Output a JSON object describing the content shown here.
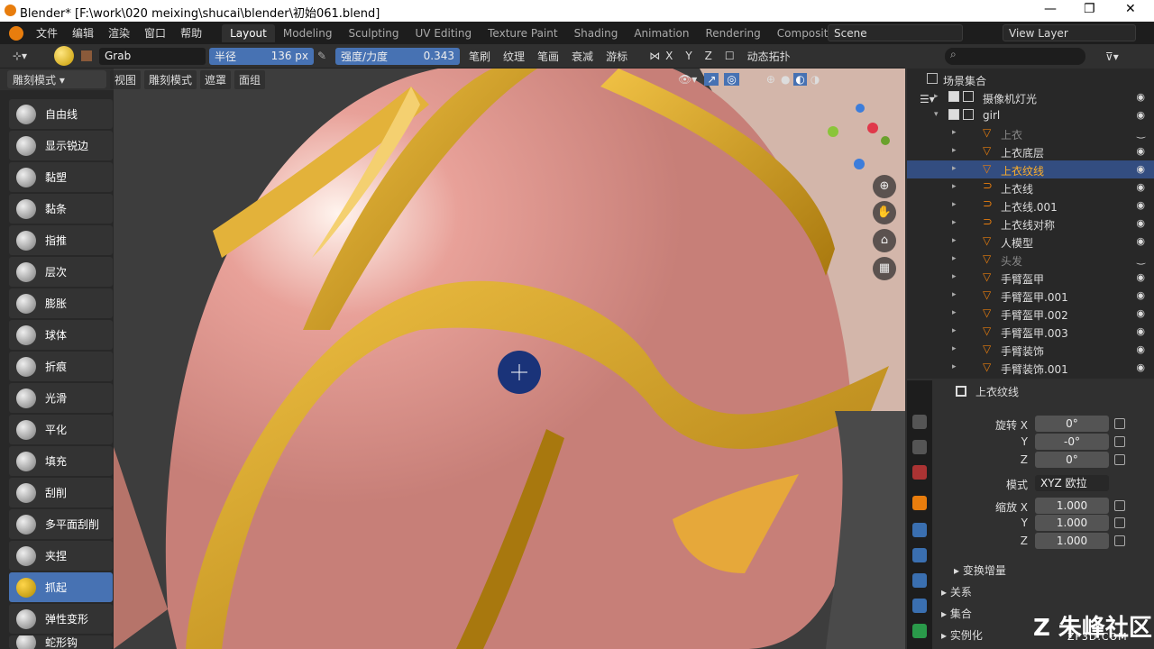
{
  "window": {
    "title": "Blender* [F:\\work\\020 meixing\\shucai\\blender\\初始061.blend]",
    "min": "—",
    "max": "❐",
    "close": "✕"
  },
  "menus": [
    "文件",
    "编辑",
    "渲染",
    "窗口",
    "帮助"
  ],
  "workspaces": [
    "Layout",
    "Modeling",
    "Sculpting",
    "UV Editing",
    "Texture Paint",
    "Shading",
    "Animation",
    "Rendering",
    "Compositing",
    "Sc"
  ],
  "scene": "Scene",
  "view_layer": "View Layer",
  "tool_header": {
    "brush": "Grab",
    "radius_label": "半径",
    "radius_value": "136 px",
    "strength_label": "强度/力度",
    "strength_value": "0.343",
    "menus": [
      "笔刷",
      "纹理",
      "笔画",
      "衰减",
      "游标"
    ],
    "axes": [
      "X",
      "Y",
      "Z"
    ],
    "dyntopo": "动态拓扑"
  },
  "viewport_header": {
    "mode": "雕刻模式",
    "menus": [
      "视图",
      "雕刻模式",
      "遮罩",
      "面组"
    ]
  },
  "tools": [
    "自由线",
    "显示锐边",
    "黏塑",
    "黏条",
    "指推",
    "层次",
    "膨胀",
    "球体",
    "折痕",
    "光滑",
    "平化",
    "填充",
    "刮削",
    "多平面刮削",
    "夹捏",
    "抓起",
    "弹性变形",
    "蛇形钩"
  ],
  "active_tool": "抓起",
  "outliner": {
    "root": "场景集合",
    "items": [
      {
        "name": "摄像机灯光",
        "level": 1,
        "type": "coll"
      },
      {
        "name": "girl",
        "level": 1,
        "type": "coll"
      },
      {
        "name": "上衣",
        "level": 2,
        "type": "mesh",
        "dim": true
      },
      {
        "name": "上衣底层",
        "level": 2,
        "type": "mesh"
      },
      {
        "name": "上衣纹线",
        "level": 2,
        "type": "mesh",
        "sel": true
      },
      {
        "name": "上衣线",
        "level": 2,
        "type": "curve"
      },
      {
        "name": "上衣线.001",
        "level": 2,
        "type": "curve"
      },
      {
        "name": "上衣线对称",
        "level": 2,
        "type": "curve"
      },
      {
        "name": "人模型",
        "level": 2,
        "type": "mesh"
      },
      {
        "name": "头发",
        "level": 2,
        "type": "mesh",
        "dim": true
      },
      {
        "name": "手臂盔甲",
        "level": 2,
        "type": "mesh"
      },
      {
        "name": "手臂盔甲.001",
        "level": 2,
        "type": "mesh"
      },
      {
        "name": "手臂盔甲.002",
        "level": 2,
        "type": "mesh"
      },
      {
        "name": "手臂盔甲.003",
        "level": 2,
        "type": "mesh"
      },
      {
        "name": "手臂装饰",
        "level": 2,
        "type": "mesh"
      },
      {
        "name": "手臂装饰.001",
        "level": 2,
        "type": "mesh"
      }
    ]
  },
  "properties": {
    "object": "上衣纹线",
    "rotation": [
      {
        "label": "旋转 X",
        "value": "0°"
      },
      {
        "label": "Y",
        "value": "-0°"
      },
      {
        "label": "Z",
        "value": "0°"
      }
    ],
    "mode_label": "模式",
    "mode_value": "XYZ 欧拉",
    "scale": [
      {
        "label": "缩放 X",
        "value": "1.000"
      },
      {
        "label": "Y",
        "value": "1.000"
      },
      {
        "label": "Z",
        "value": "1.000"
      }
    ],
    "sections": [
      "变换增量",
      "关系",
      "集合",
      "实例化"
    ]
  },
  "watermark": {
    "brand": "朱峰社区",
    "url": "ZF3D.COM"
  },
  "colors": {
    "accent": "#4772b3",
    "orange": "#e87d0d",
    "gold": "#d4a020"
  }
}
